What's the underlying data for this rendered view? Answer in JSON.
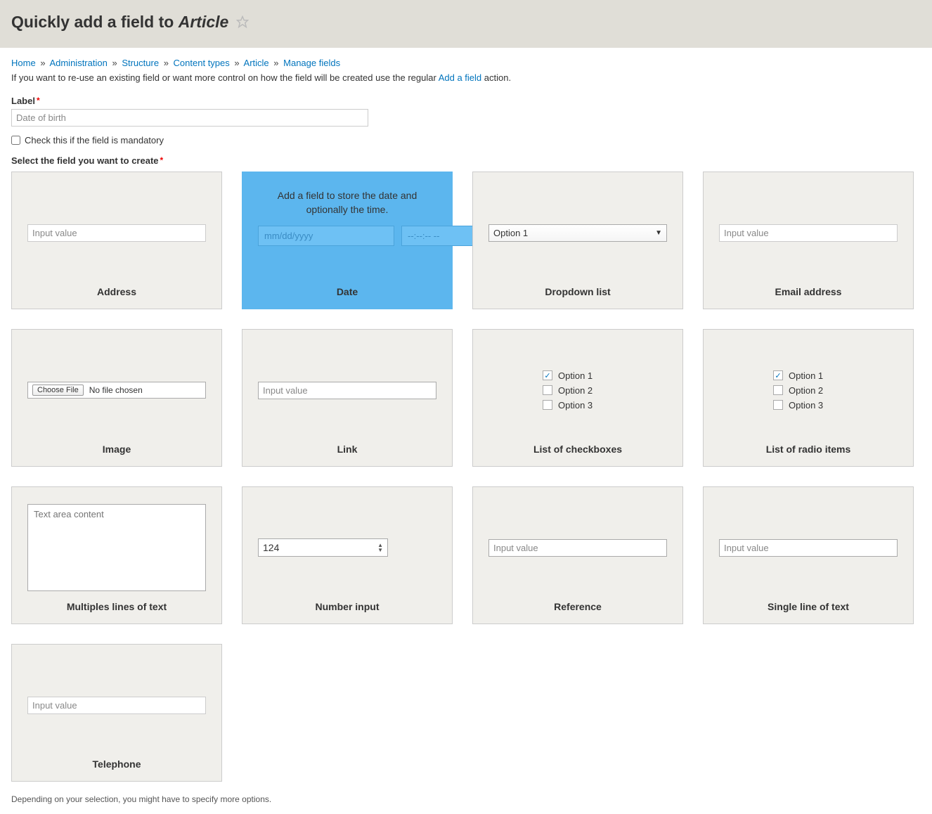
{
  "header": {
    "title_prefix": "Quickly add a field to ",
    "title_subject": "Article"
  },
  "breadcrumb": {
    "items": [
      "Home",
      "Administration",
      "Structure",
      "Content types",
      "Article"
    ],
    "current": "Manage fields",
    "sep": "»"
  },
  "intro": {
    "text_before": "If you want to re-use an existing field or want more control on how the field will be created use the regular ",
    "link": "Add a field",
    "text_after": " action."
  },
  "form": {
    "label_label": "Label",
    "label_value": "Date of birth",
    "mandatory_checkbox_label": "Check this if the field is mandatory",
    "section_label": "Select the field you want to create"
  },
  "cards": {
    "address": {
      "title": "Address",
      "placeholder": "Input value"
    },
    "date": {
      "title": "Date",
      "description": "Add a field to store the date and optionally the time.",
      "date_placeholder": "mm/dd/yyyy",
      "time_placeholder": "--:--:-- --"
    },
    "dropdown": {
      "title": "Dropdown list",
      "option": "Option 1"
    },
    "email": {
      "title": "Email address",
      "placeholder": "Input value"
    },
    "image": {
      "title": "Image",
      "button": "Choose File",
      "no_file": "No file chosen"
    },
    "link": {
      "title": "Link",
      "placeholder": "Input value"
    },
    "checkboxes": {
      "title": "List of checkboxes",
      "options": [
        "Option 1",
        "Option 2",
        "Option 3"
      ]
    },
    "radios": {
      "title": "List of radio items",
      "options": [
        "Option 1",
        "Option 2",
        "Option 3"
      ]
    },
    "textarea": {
      "title": "Multiples lines of text",
      "placeholder": "Text area content"
    },
    "number": {
      "title": "Number input",
      "value": "124"
    },
    "reference": {
      "title": "Reference",
      "placeholder": "Input value"
    },
    "single_text": {
      "title": "Single line of text",
      "placeholder": "Input value"
    },
    "telephone": {
      "title": "Telephone",
      "placeholder": "Input value"
    }
  },
  "footer": {
    "note": "Depending on your selection, you might have to specify more options."
  }
}
